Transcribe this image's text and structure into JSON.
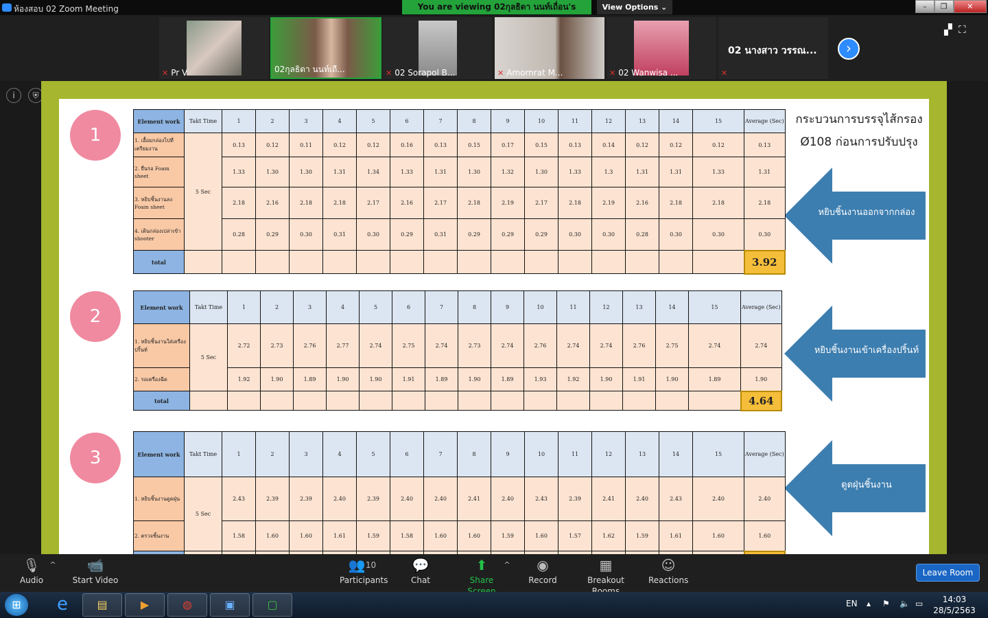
{
  "window": {
    "title": "ห้องสอบ 02   Zoom Meeting",
    "viewing_banner": "You are viewing 02กุลธิดา นนท์เถื่อน's screen",
    "view_options": "View Options ⌄",
    "minimize": "–",
    "restore": "❐",
    "close": "✕"
  },
  "participants": [
    {
      "name": "Pr V",
      "muted": true
    },
    {
      "name": "02กุลธิดา นนท์เถื...",
      "muted": false
    },
    {
      "name": "02 Sorapol B...",
      "muted": true
    },
    {
      "name": "Amornrat M...",
      "muted": true
    },
    {
      "name": "02 Wanwisa ...",
      "muted": true
    },
    {
      "name": "02 นางสาว วรรณ...",
      "muted": true
    }
  ],
  "slide": {
    "title_line1": "กระบวนการบรรจุไส้กรอง",
    "title_line2": "Ø108 ก่อนการปรับปรุง",
    "headers": {
      "element": "Element work",
      "takt": "Takt Time",
      "average": "Average (Sec)",
      "total": "total",
      "takt_value": "5 Sec"
    },
    "columns": [
      "1",
      "2",
      "3",
      "4",
      "5",
      "6",
      "7",
      "8",
      "9",
      "10",
      "11",
      "12",
      "13",
      "14",
      "15"
    ],
    "sections": [
      {
        "number": "1",
        "arrow_label": "หยิบชิ้นงานออกจากกล่อง",
        "total": "3.92",
        "rows": [
          {
            "element": "1. เอื้อมกล่องไปที่เตรียมงาน",
            "values": [
              "0.13",
              "0.12",
              "0.11",
              "0.12",
              "0.12",
              "0.16",
              "0.13",
              "0.15",
              "0.17",
              "0.15",
              "0.13",
              "0.14",
              "0.12",
              "0.12",
              "0.12"
            ],
            "avg": "0.13"
          },
          {
            "element": "2. ยื่นรอ Foam sheet",
            "values": [
              "1.33",
              "1.30",
              "1.30",
              "1.31",
              "1.34",
              "1.33",
              "1.31",
              "1.30",
              "1.32",
              "1.30",
              "1.33",
              "1.3",
              "1.31",
              "1.31",
              "1.33"
            ],
            "avg": "1.31"
          },
          {
            "element": "3. หยิบชิ้นงานลง Foam sheet",
            "values": [
              "2.18",
              "2.16",
              "2.18",
              "2.18",
              "2.17",
              "2.16",
              "2.17",
              "2.18",
              "2.19",
              "2.17",
              "2.18",
              "2.19",
              "2.16",
              "2.18",
              "2.18"
            ],
            "avg": "2.18"
          },
          {
            "element": "4. เดินกล่องเปล่าเข้า shooter",
            "values": [
              "0.28",
              "0.29",
              "0.30",
              "0.31",
              "0.30",
              "0.29",
              "0.31",
              "0.29",
              "0.29",
              "0.29",
              "0.30",
              "0.30",
              "0.28",
              "0.30",
              "0.30"
            ],
            "avg": "0.30"
          }
        ]
      },
      {
        "number": "2",
        "arrow_label": "หยิบชิ้นงานเข้าเครื่องปริ้นท์",
        "total": "4.64",
        "rows": [
          {
            "element": "1. หยิบชิ้นงานใส่เครื่องปริ้นท์",
            "values": [
              "2.72",
              "2.73",
              "2.76",
              "2.77",
              "2.74",
              "2.75",
              "2.74",
              "2.73",
              "2.74",
              "2.76",
              "2.74",
              "2.74",
              "2.76",
              "2.75",
              "2.74"
            ],
            "avg": "2.74"
          },
          {
            "element": "2. รอเครื่องฉีด",
            "values": [
              "1.92",
              "1.90",
              "1.89",
              "1.90",
              "1.90",
              "1.91",
              "1.89",
              "1.90",
              "1.89",
              "1.93",
              "1.92",
              "1.90",
              "1.91",
              "1.90",
              "1.89"
            ],
            "avg": "1.90"
          }
        ]
      },
      {
        "number": "3",
        "arrow_label": "ดูดฝุ่นชิ้นงาน",
        "rows": [
          {
            "element": "1. หยิบชิ้นงานดูดฝุ่น",
            "values": [
              "2.43",
              "2.39",
              "2.39",
              "2.40",
              "2.39",
              "2.40",
              "2.40",
              "2.41",
              "2.40",
              "2.43",
              "2.39",
              "2.41",
              "2.40",
              "2.43",
              "2.40"
            ],
            "avg": "2.40"
          },
          {
            "element": "2. ตรวจชิ้นงาน",
            "values": [
              "1.58",
              "1.60",
              "1.60",
              "1.61",
              "1.59",
              "1.58",
              "1.60",
              "1.60",
              "1.59",
              "1.60",
              "1.57",
              "1.62",
              "1.59",
              "1.61",
              "1.60"
            ],
            "avg": "1.60"
          }
        ]
      }
    ]
  },
  "toolbar": {
    "audio": "Audio",
    "start_video": "Start Video",
    "participants": "Participants",
    "participant_count": "10",
    "chat": "Chat",
    "share_screen": "Share Screen",
    "record": "Record",
    "breakout": "Breakout Rooms",
    "reactions": "Reactions",
    "leave": "Leave Room"
  },
  "taskbar": {
    "lang": "EN",
    "time": "14:03",
    "date": "28/5/2563"
  },
  "colors": {
    "share_green": "#23a33a",
    "zoom_blue": "#2d8cff",
    "slide_border": "#a6b62e",
    "arrow": "#3d7eb0",
    "circle": "#f08aa0",
    "avg_cell": "#f5be3a"
  }
}
